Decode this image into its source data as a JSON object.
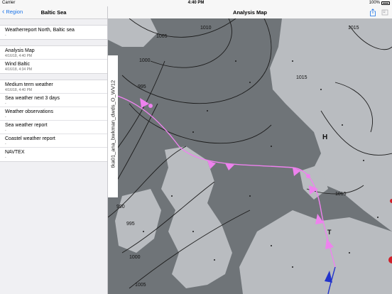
{
  "status_bar": {
    "carrier": "Carrier",
    "time": "4:40 PM",
    "battery": "100%"
  },
  "sidebar": {
    "back_label": "Region",
    "title": "Baltic Sea",
    "groups": [
      [
        {
          "title": "Weatherreport North, Baltic sea",
          "sub": "-"
        }
      ],
      [
        {
          "title": "Analysis Map",
          "sub": "4/16/18, 4:40 PM"
        },
        {
          "title": "Wind Baltic",
          "sub": "4/16/18, 4:34 PM"
        }
      ],
      [
        {
          "title": "Medium term weather",
          "sub": "4/16/18, 4:40 PM"
        },
        {
          "title": "Sea weather next 3 days",
          "sub": "-"
        },
        {
          "title": "Weather observations",
          "sub": "-"
        },
        {
          "title": "Sea weather report",
          "sub": "-"
        },
        {
          "title": "Coastel weather report",
          "sub": "-"
        },
        {
          "title": "NAVTEX",
          "sub": "-"
        }
      ]
    ]
  },
  "main": {
    "title": "Analysis Map",
    "map": {
      "vertical_label": "tka01_ana_bwkman_dwds_O_WV12",
      "isobar_labels": [
        "1010",
        "1005",
        "1000",
        "995",
        "1015",
        "1015",
        "1015",
        "985",
        "990",
        "995",
        "1000",
        "1005"
      ],
      "pressure_centers": [
        "H",
        "T"
      ]
    }
  },
  "colors": {
    "accent": "#1a73e8",
    "land": "#b9bcc0",
    "sea": "#6f7478",
    "front_warm": "#ee82ee",
    "front_cold": "#2233cc",
    "isobar": "#1c1c1c"
  }
}
